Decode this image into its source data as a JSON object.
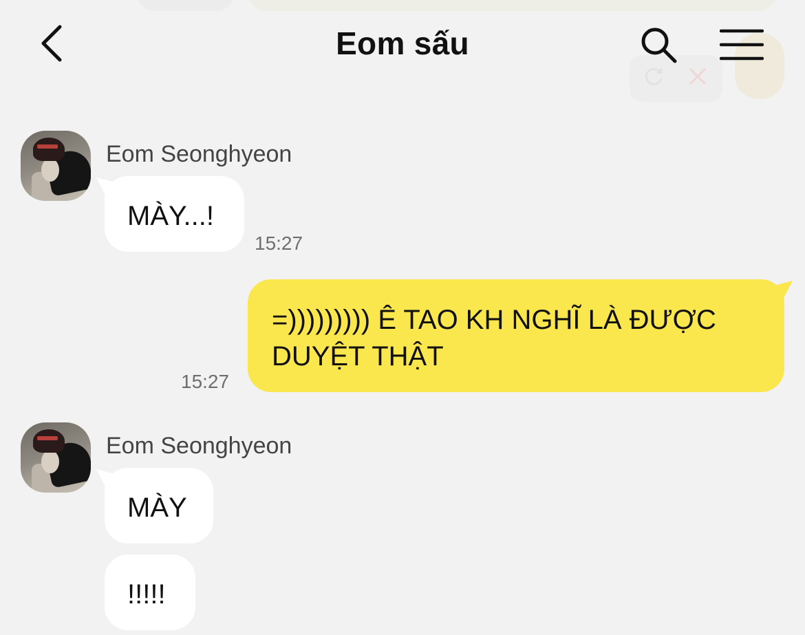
{
  "header": {
    "title": "Eom sấu",
    "back_icon": "chevron-left-icon",
    "search_icon": "search-icon",
    "menu_icon": "hamburger-menu-icon"
  },
  "messages": [
    {
      "direction": "incoming",
      "sender": "Eom Seonghyeon",
      "bubbles": [
        "MÀY...!"
      ],
      "time": "15:27"
    },
    {
      "direction": "outgoing",
      "text_line1": "=))))))))) Ê TAO KH NGHĨ LÀ ĐƯỢC",
      "text_line2": "DUYỆT THẬT",
      "time": "15:27"
    },
    {
      "direction": "incoming",
      "sender": "Eom Seonghyeon",
      "bubbles": [
        "MÀY",
        "!!!!!"
      ]
    }
  ],
  "colors": {
    "background": "#f2f2f2",
    "outgoing_bubble": "#fae74e",
    "incoming_bubble": "#ffffff"
  }
}
